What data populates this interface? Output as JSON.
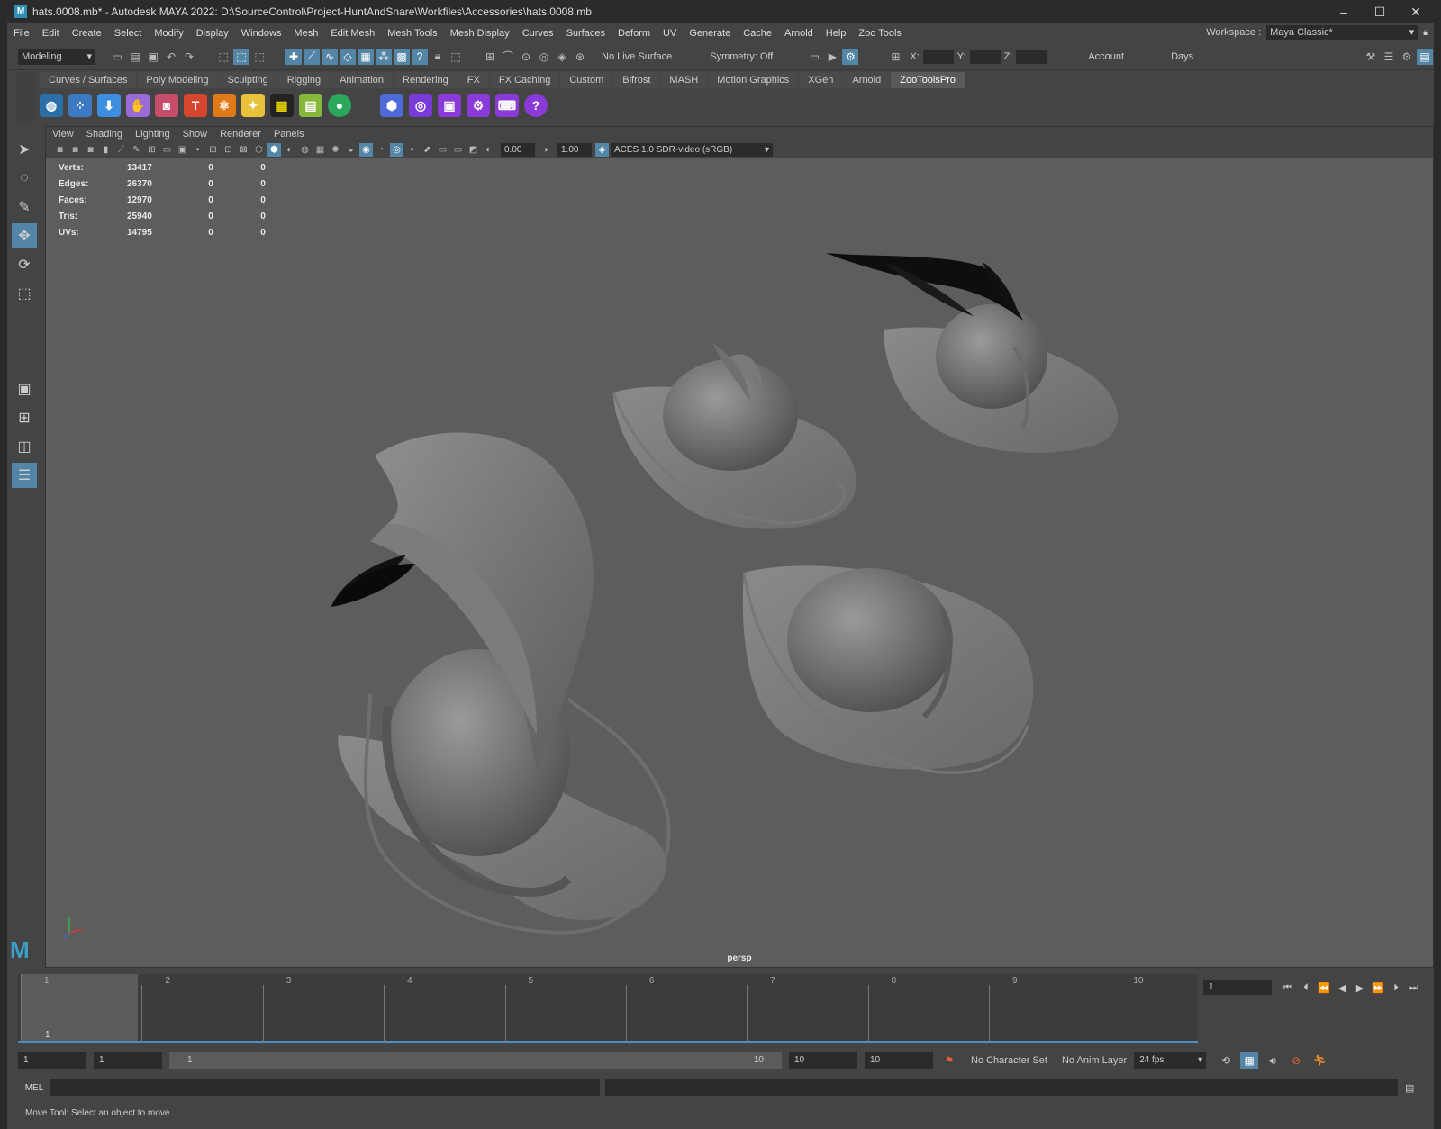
{
  "window": {
    "title": "hats.0008.mb* - Autodesk MAYA 2022: D:\\SourceControl\\Project-HuntAndSnare\\Workfiles\\Accessories\\hats.0008.mb",
    "app_icon": "M"
  },
  "menubar": [
    "File",
    "Edit",
    "Create",
    "Select",
    "Modify",
    "Display",
    "Windows",
    "Mesh",
    "Edit Mesh",
    "Mesh Tools",
    "Mesh Display",
    "Curves",
    "Surfaces",
    "Deform",
    "UV",
    "Generate",
    "Cache",
    "Arnold",
    "Help",
    "Zoo Tools"
  ],
  "workspace": {
    "label": "Workspace :",
    "value": "Maya Classic*"
  },
  "statusline": {
    "menuset": "Modeling",
    "live_surface": "No Live Surface",
    "symmetry": "Symmetry: Off",
    "x_label": "X:",
    "y_label": "Y:",
    "z_label": "Z:",
    "account": "Account",
    "days": "Days"
  },
  "shelf": {
    "tabs": [
      "Curves / Surfaces",
      "Poly Modeling",
      "Sculpting",
      "Rigging",
      "Animation",
      "Rendering",
      "FX",
      "FX Caching",
      "Custom",
      "Bifrost",
      "MASH",
      "Motion Graphics",
      "XGen",
      "Arnold",
      "ZooToolsPro"
    ],
    "active_tab": "ZooToolsPro"
  },
  "panel": {
    "menu": [
      "View",
      "Shading",
      "Lighting",
      "Show",
      "Renderer",
      "Panels"
    ],
    "exposure": "0.00",
    "gamma": "1.00",
    "color_space": "ACES 1.0 SDR-video (sRGB)",
    "camera": "persp"
  },
  "hud": [
    {
      "label": "Verts:",
      "v1": "13417",
      "v2": "0",
      "v3": "0"
    },
    {
      "label": "Edges:",
      "v1": "26370",
      "v2": "0",
      "v3": "0"
    },
    {
      "label": "Faces:",
      "v1": "12970",
      "v2": "0",
      "v3": "0"
    },
    {
      "label": "Tris:",
      "v1": "25940",
      "v2": "0",
      "v3": "0"
    },
    {
      "label": "UVs:",
      "v1": "14795",
      "v2": "0",
      "v3": "0"
    }
  ],
  "timeslider": {
    "frames": [
      "1",
      "2",
      "3",
      "4",
      "5",
      "6",
      "7",
      "8",
      "9",
      "10"
    ],
    "current": "1"
  },
  "playback": {
    "current_frame": "1"
  },
  "range": {
    "start": "1",
    "anim_start": "1",
    "bar_start": "1",
    "bar_end": "10",
    "anim_end": "10",
    "end": "10",
    "character_set": "No Character Set",
    "anim_layer": "No Anim Layer",
    "fps": "24 fps"
  },
  "cmdline": {
    "label": "MEL"
  },
  "helpline": "Move Tool: Select an object to move."
}
